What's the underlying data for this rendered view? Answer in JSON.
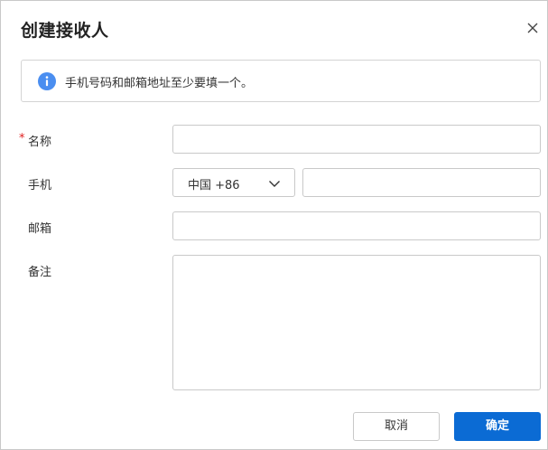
{
  "dialog": {
    "title": "创建接收人"
  },
  "notice": {
    "text": "手机号码和邮箱地址至少要填一个。",
    "icon": "info-icon",
    "icon_color": "#4a8ef0"
  },
  "form": {
    "required_mark": "*",
    "name": {
      "label": "名称",
      "value": ""
    },
    "phone": {
      "label": "手机",
      "country_code": "中国 +86",
      "value": ""
    },
    "email": {
      "label": "邮箱",
      "value": ""
    },
    "remark": {
      "label": "备注",
      "value": ""
    }
  },
  "buttons": {
    "cancel": "取消",
    "confirm": "确定",
    "confirm_color": "#0b6bd4"
  }
}
